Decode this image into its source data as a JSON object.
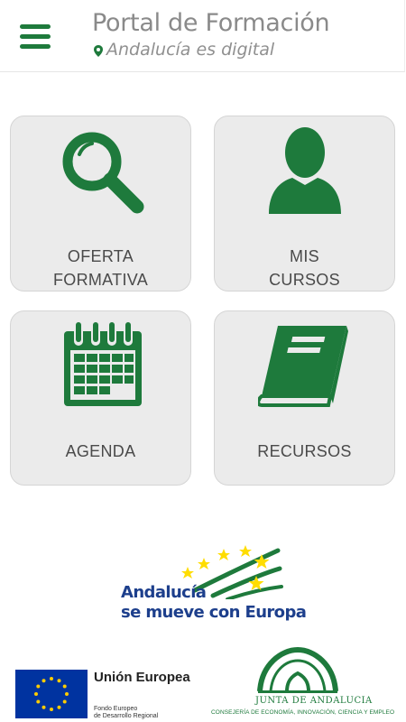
{
  "header": {
    "title": "Portal de Formación",
    "tagline": "Andalucía es digital"
  },
  "tiles": [
    {
      "label_line1": "OFERTA",
      "label_line2": "FORMATIVA",
      "icon": "search-icon"
    },
    {
      "label_line1": "MIS",
      "label_line2": "CURSOS",
      "icon": "user-icon"
    },
    {
      "label_line1": "AGENDA",
      "icon": "calendar-icon"
    },
    {
      "label_line1": "RECURSOS",
      "icon": "book-icon"
    }
  ],
  "footer": {
    "andalucia_line1": "Andalucía",
    "andalucia_line2": "se mueve con Europa",
    "eu_name": "Unión Europea",
    "eu_fund_line1": "Fondo Europeo",
    "eu_fund_line2": "de Desarrollo Regional",
    "junta_name": "JUNTA DE ANDALUCIA",
    "junta_sub": "CONSEJERÍA DE ECONOMÍA, INNOVACIÓN, CIENCIA Y EMPLEO"
  },
  "colors": {
    "brand_green": "#1e7a3c",
    "tile_bg": "#ebebeb",
    "eu_blue": "#0033a0",
    "eu_yellow": "#ffcc00",
    "andalucia_blue": "#1d3f8c"
  }
}
